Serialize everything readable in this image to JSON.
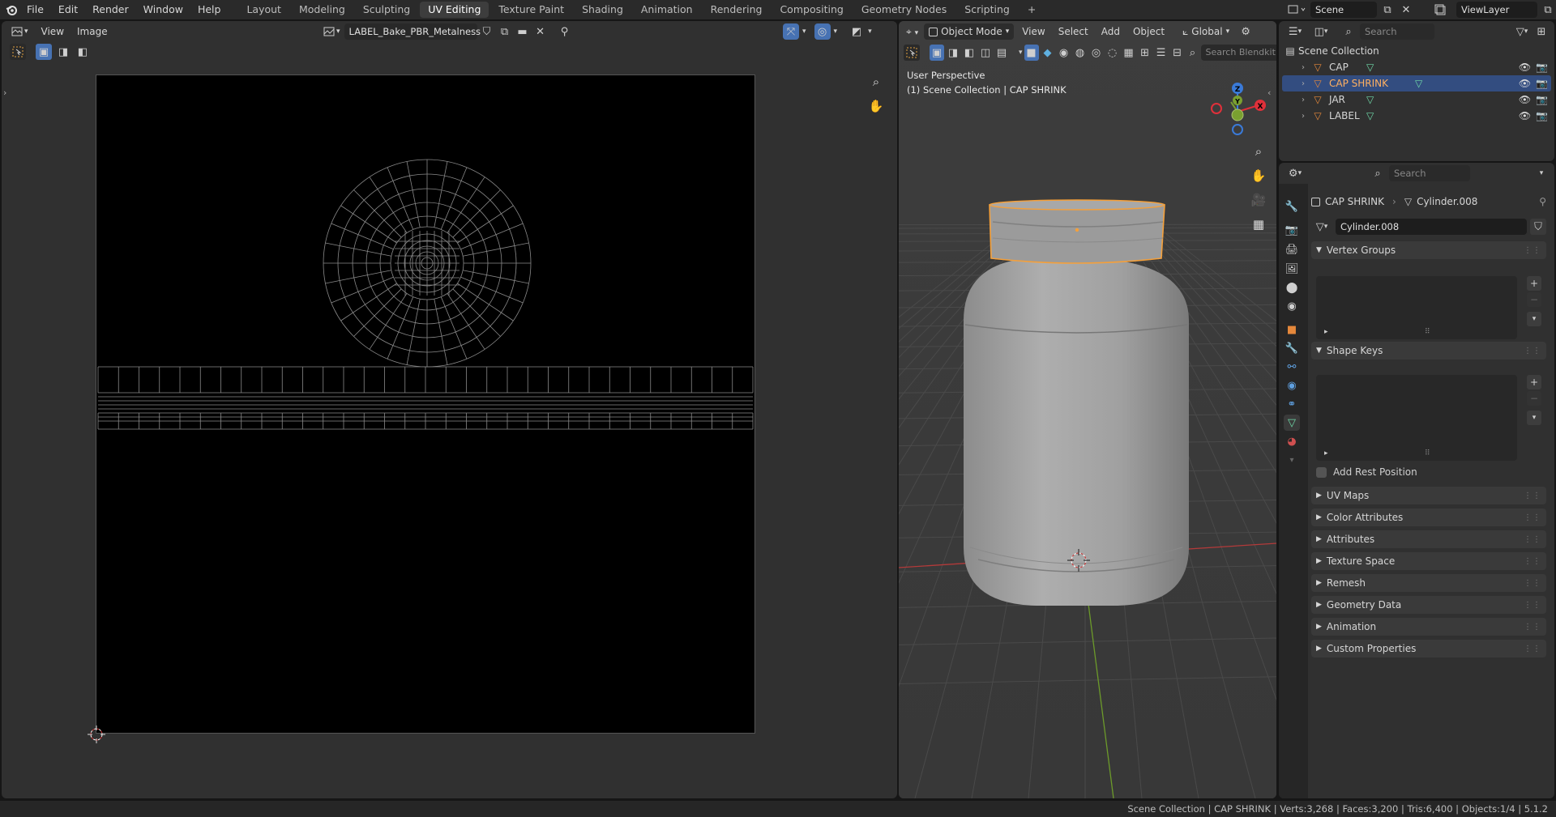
{
  "topbar": {
    "menus": [
      "File",
      "Edit",
      "Render",
      "Window",
      "Help"
    ],
    "workspaces": [
      "Layout",
      "Modeling",
      "Sculpting",
      "UV Editing",
      "Texture Paint",
      "Shading",
      "Animation",
      "Rendering",
      "Compositing",
      "Geometry Nodes",
      "Scripting"
    ],
    "active_workspace": "UV Editing",
    "add_tab": "+",
    "scene": "Scene",
    "view_layer": "ViewLayer"
  },
  "uv_editor": {
    "menus": [
      "View",
      "Image"
    ],
    "image_name": "LABEL_Bake_PBR_Metalness"
  },
  "viewport": {
    "mode": "Object Mode",
    "menus": [
      "View",
      "Select",
      "Add",
      "Object"
    ],
    "transform_orientation": "Global",
    "search_placeholder": "Search Blendkit",
    "overlay_line1": "User Perspective",
    "overlay_line2": "(1) Scene Collection | CAP SHRINK",
    "gizmo": {
      "x": "X",
      "y": "Y",
      "z": "Z"
    }
  },
  "outliner": {
    "search_placeholder": "Search",
    "root": "Scene Collection",
    "items": [
      {
        "name": "CAP",
        "selected": false
      },
      {
        "name": "CAP SHRINK",
        "selected": true
      },
      {
        "name": "JAR",
        "selected": false
      },
      {
        "name": "LABEL",
        "selected": false
      }
    ]
  },
  "properties": {
    "search_placeholder": "Search",
    "object_name": "CAP SHRINK",
    "data_name": "Cylinder.008",
    "mesh_field": "Cylinder.008",
    "vertex_groups_label": "Vertex Groups",
    "shape_keys_label": "Shape Keys",
    "add_rest_position": "Add Rest Position",
    "collapsed_panels": [
      "UV Maps",
      "Color Attributes",
      "Attributes",
      "Texture Space",
      "Remesh",
      "Geometry Data",
      "Animation",
      "Custom Properties"
    ]
  },
  "statusbar": {
    "text": "Scene Collection | CAP SHRINK | Verts:3,268 | Faces:3,200 | Tris:6,400 | Objects:1/4 | 5.1.2"
  },
  "colors": {
    "accent_blue": "#4772b3",
    "selection_orange": "#f5a03a",
    "mesh_green": "#6fd9a8",
    "object_orange": "#e5883b"
  }
}
